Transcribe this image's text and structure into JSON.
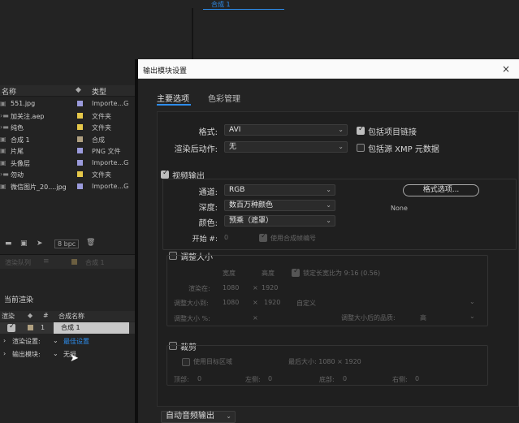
{
  "background": {
    "comp_tab": "合成 1",
    "project_headers": {
      "name": "名称",
      "type": "类型"
    },
    "project_items": [
      {
        "name": "551.jpg",
        "type": "Importe...G",
        "color": "#9b9bdc"
      },
      {
        "name": "加关注.aep",
        "type": "文件夹",
        "color": "#e6c84a"
      },
      {
        "name": "纯色",
        "type": "文件夹",
        "color": "#e6c84a"
      },
      {
        "name": "合成 1",
        "type": "合成",
        "color": "#b0a080"
      },
      {
        "name": "片尾",
        "type": "PNG 文件",
        "color": "#9b9bdc"
      },
      {
        "name": "头像层",
        "type": "Importe...G",
        "color": "#9b9bdc"
      },
      {
        "name": "勿动",
        "type": "文件夹",
        "color": "#e6c84a"
      },
      {
        "name": "微信图片_20....jpg",
        "type": "Importe...G",
        "color": "#9b9bdc"
      }
    ],
    "bpc": "8 bpc",
    "queue_tab": "渲染队列",
    "queue_comp_tab": "合成 1",
    "current_render": "当前渲染",
    "render_headers": {
      "render": "渲染",
      "num": "#",
      "comp_name": "合成名称"
    },
    "render_row": {
      "num": "1",
      "comp": "合成 1"
    },
    "render_settings_label": "渲染设置:",
    "render_settings_value": "最佳设置",
    "output_module_label": "输出模块:",
    "output_module_value": "无损"
  },
  "dialog": {
    "title": "输出模块设置",
    "close": "×",
    "tabs": [
      "主要选项",
      "色彩管理"
    ],
    "format_label": "格式:",
    "format_value": "AVI",
    "post_render_label": "渲染后动作:",
    "post_render_value": "无",
    "include_link": "包括项目链接",
    "include_xmp": "包括源 XMP 元数据",
    "video_output": "视频输出",
    "channels_label": "通道:",
    "channels_value": "RGB",
    "depth_label": "深度:",
    "depth_value": "数百万种颜色",
    "color_label": "颜色:",
    "color_value": "预乘（遮罩）",
    "start_label": "开始 #:",
    "start_value": "0",
    "use_comp_frame": "使用合成帧编号",
    "format_options_btn": "格式选项...",
    "codec_none": "None",
    "resize": "调整大小",
    "width": "宽度",
    "height": "高度",
    "lock_ratio": "锁定长宽比为 9:16 (0.56)",
    "render_at_label": "渲染在:",
    "render_at_w": "1080",
    "render_at_h": "1920",
    "resize_to_label": "调整大小到:",
    "resize_to_w": "1080",
    "resize_to_h": "1920",
    "custom": "自定义",
    "resize_pct_label": "调整大小 %:",
    "resize_quality_label": "调整大小后的品质:",
    "resize_quality_value": "高",
    "crop": "裁剪",
    "use_roi": "使用目标区域",
    "final_size": "最后大小: 1080 × 1920",
    "top_label": "顶部:",
    "top_value": "0",
    "left_label": "左侧:",
    "left_value": "0",
    "bottom_label": "底部:",
    "bottom_value": "0",
    "right_label": "右侧:",
    "right_value": "0",
    "audio_output": "自动音频输出"
  }
}
